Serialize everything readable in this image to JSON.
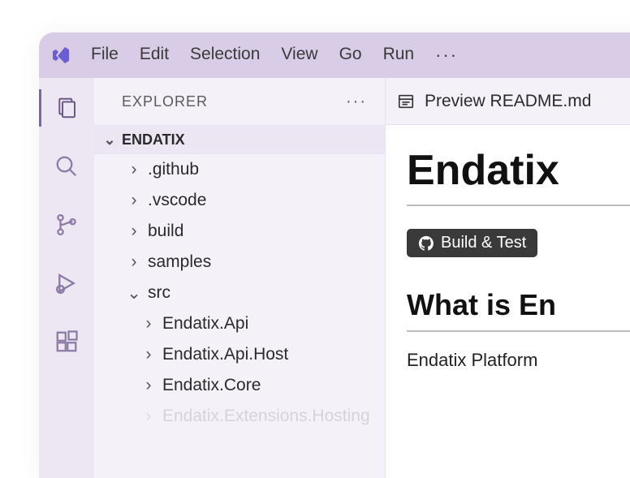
{
  "menubar": {
    "items": [
      "File",
      "Edit",
      "Selection",
      "View",
      "Go",
      "Run"
    ]
  },
  "sidebar": {
    "title": "EXPLORER",
    "root": "ENDATIX",
    "tree": [
      {
        "label": ".github",
        "expanded": false,
        "depth": 1
      },
      {
        "label": ".vscode",
        "expanded": false,
        "depth": 1
      },
      {
        "label": "build",
        "expanded": false,
        "depth": 1
      },
      {
        "label": "samples",
        "expanded": false,
        "depth": 1
      },
      {
        "label": "src",
        "expanded": true,
        "depth": 1
      },
      {
        "label": "Endatix.Api",
        "expanded": false,
        "depth": 2
      },
      {
        "label": "Endatix.Api.Host",
        "expanded": false,
        "depth": 2
      },
      {
        "label": "Endatix.Core",
        "expanded": false,
        "depth": 2
      },
      {
        "label": "Endatix.Extensions.Hosting",
        "expanded": false,
        "depth": 2,
        "faded": true
      }
    ]
  },
  "editor": {
    "tab_label": "Preview README.md",
    "h1": "Endatix",
    "badge": "Build & Test",
    "h2": "What is En",
    "paragraph": "Endatix Platform"
  }
}
